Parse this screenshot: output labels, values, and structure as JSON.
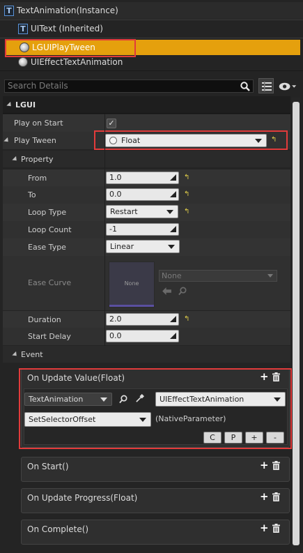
{
  "tree": {
    "root_label": "TextAnimation(Instance)",
    "items": [
      {
        "label": "UIText (Inherited)",
        "icon": "text-component-icon"
      },
      {
        "label": "LGUIPlayTween",
        "icon": "gear-component-icon"
      },
      {
        "label": "UIEffectTextAnimation",
        "icon": "gear-component-icon"
      }
    ]
  },
  "search": {
    "placeholder": "Search Details"
  },
  "details": {
    "category": "LGUI",
    "play_on_start": {
      "label": "Play on Start",
      "checked": true
    },
    "play_tween": {
      "label": "Play Tween",
      "value": "Float"
    },
    "property": {
      "label": "Property",
      "from": {
        "label": "From",
        "value": "1.0"
      },
      "to": {
        "label": "To",
        "value": "0.0"
      },
      "loop_type": {
        "label": "Loop Type",
        "value": "Restart"
      },
      "loop_count": {
        "label": "Loop Count",
        "value": "-1"
      },
      "ease_type": {
        "label": "Ease Type",
        "value": "Linear"
      },
      "ease_curve": {
        "label": "Ease Curve",
        "thumb_text": "None",
        "asset_value": "None"
      },
      "duration": {
        "label": "Duration",
        "value": "2.0"
      },
      "start_delay": {
        "label": "Start Delay",
        "value": "0.0"
      }
    },
    "event": {
      "label": "Event",
      "on_update_value": {
        "title": "On Update Value(Float)",
        "target_actor": "TextAnimation",
        "target_component": "UIEffectTextAnimation",
        "function": "SetSelectorOffset",
        "param": "(NativeParameter)",
        "buttons": [
          "C",
          "P",
          "+",
          "-"
        ]
      },
      "on_start": {
        "title": "On Start()"
      },
      "on_update_progress": {
        "title": "On Update Progress(Float)"
      },
      "on_complete": {
        "title": "On Complete()"
      }
    }
  },
  "colors": {
    "highlight": "#e5a00d",
    "annotation_red": "#e23b3b",
    "reset_arrow": "#e6d34a"
  }
}
